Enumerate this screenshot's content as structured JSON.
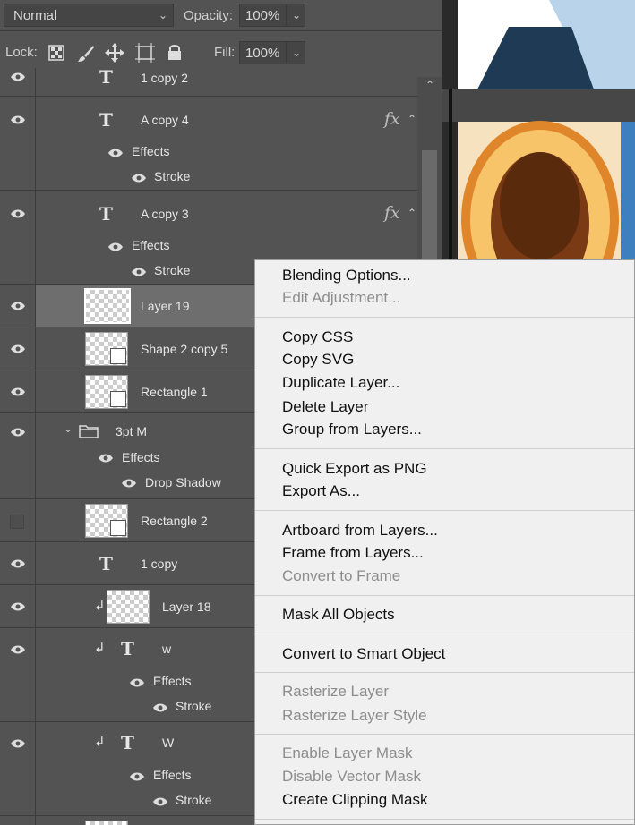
{
  "blend": {
    "mode": "Normal",
    "opacity_label": "Opacity:",
    "opacity": "100%"
  },
  "lockbar": {
    "lock_label": "Lock:",
    "fill_label": "Fill:",
    "fill": "100%"
  },
  "layers": {
    "r0": "1 copy 2",
    "r1": {
      "name": "A copy 4",
      "effects": "Effects",
      "stroke": "Stroke",
      "fx": "fx"
    },
    "r2": {
      "name": "A copy 3",
      "effects": "Effects",
      "stroke": "Stroke",
      "fx": "fx"
    },
    "r3": "Layer 19",
    "r4": "Shape 2 copy 5",
    "r5": "Rectangle 1",
    "r6": {
      "name": "3pt M",
      "effects": "Effects",
      "drop": "Drop Shadow"
    },
    "r7": "Rectangle 2",
    "r8": "1 copy",
    "r9": "Layer 18",
    "r10": {
      "name": "w",
      "effects": "Effects",
      "stroke": "Stroke"
    },
    "r11": {
      "name": "W",
      "effects": "Effects",
      "stroke": "Stroke"
    }
  },
  "menu": {
    "blending_options": "Blending Options...",
    "edit_adjustment": "Edit Adjustment...",
    "copy_css": "Copy CSS",
    "copy_svg": "Copy SVG",
    "duplicate_layer": "Duplicate Layer...",
    "delete_layer": "Delete Layer",
    "group_from_layers": "Group from Layers...",
    "quick_export": "Quick Export as PNG",
    "export_as": "Export As...",
    "artboard_from_layers": "Artboard from Layers...",
    "frame_from_layers": "Frame from Layers...",
    "convert_to_frame": "Convert to Frame",
    "mask_all_objects": "Mask All Objects",
    "convert_smart_object": "Convert to Smart Object",
    "rasterize_layer": "Rasterize Layer",
    "rasterize_layer_style": "Rasterize Layer Style",
    "enable_layer_mask": "Enable Layer Mask",
    "disable_vector_mask": "Disable Vector Mask",
    "create_clipping_mask": "Create Clipping Mask"
  },
  "icons": [
    "eye-icon",
    "text-layer-icon",
    "fx-icon",
    "folder-icon",
    "clip-arrow-icon",
    "lock-transparent-icon",
    "lock-brush-icon",
    "lock-move-icon",
    "lock-artboard-icon",
    "lock-all-icon",
    "chevron-down-icon",
    "chevron-up-icon"
  ]
}
